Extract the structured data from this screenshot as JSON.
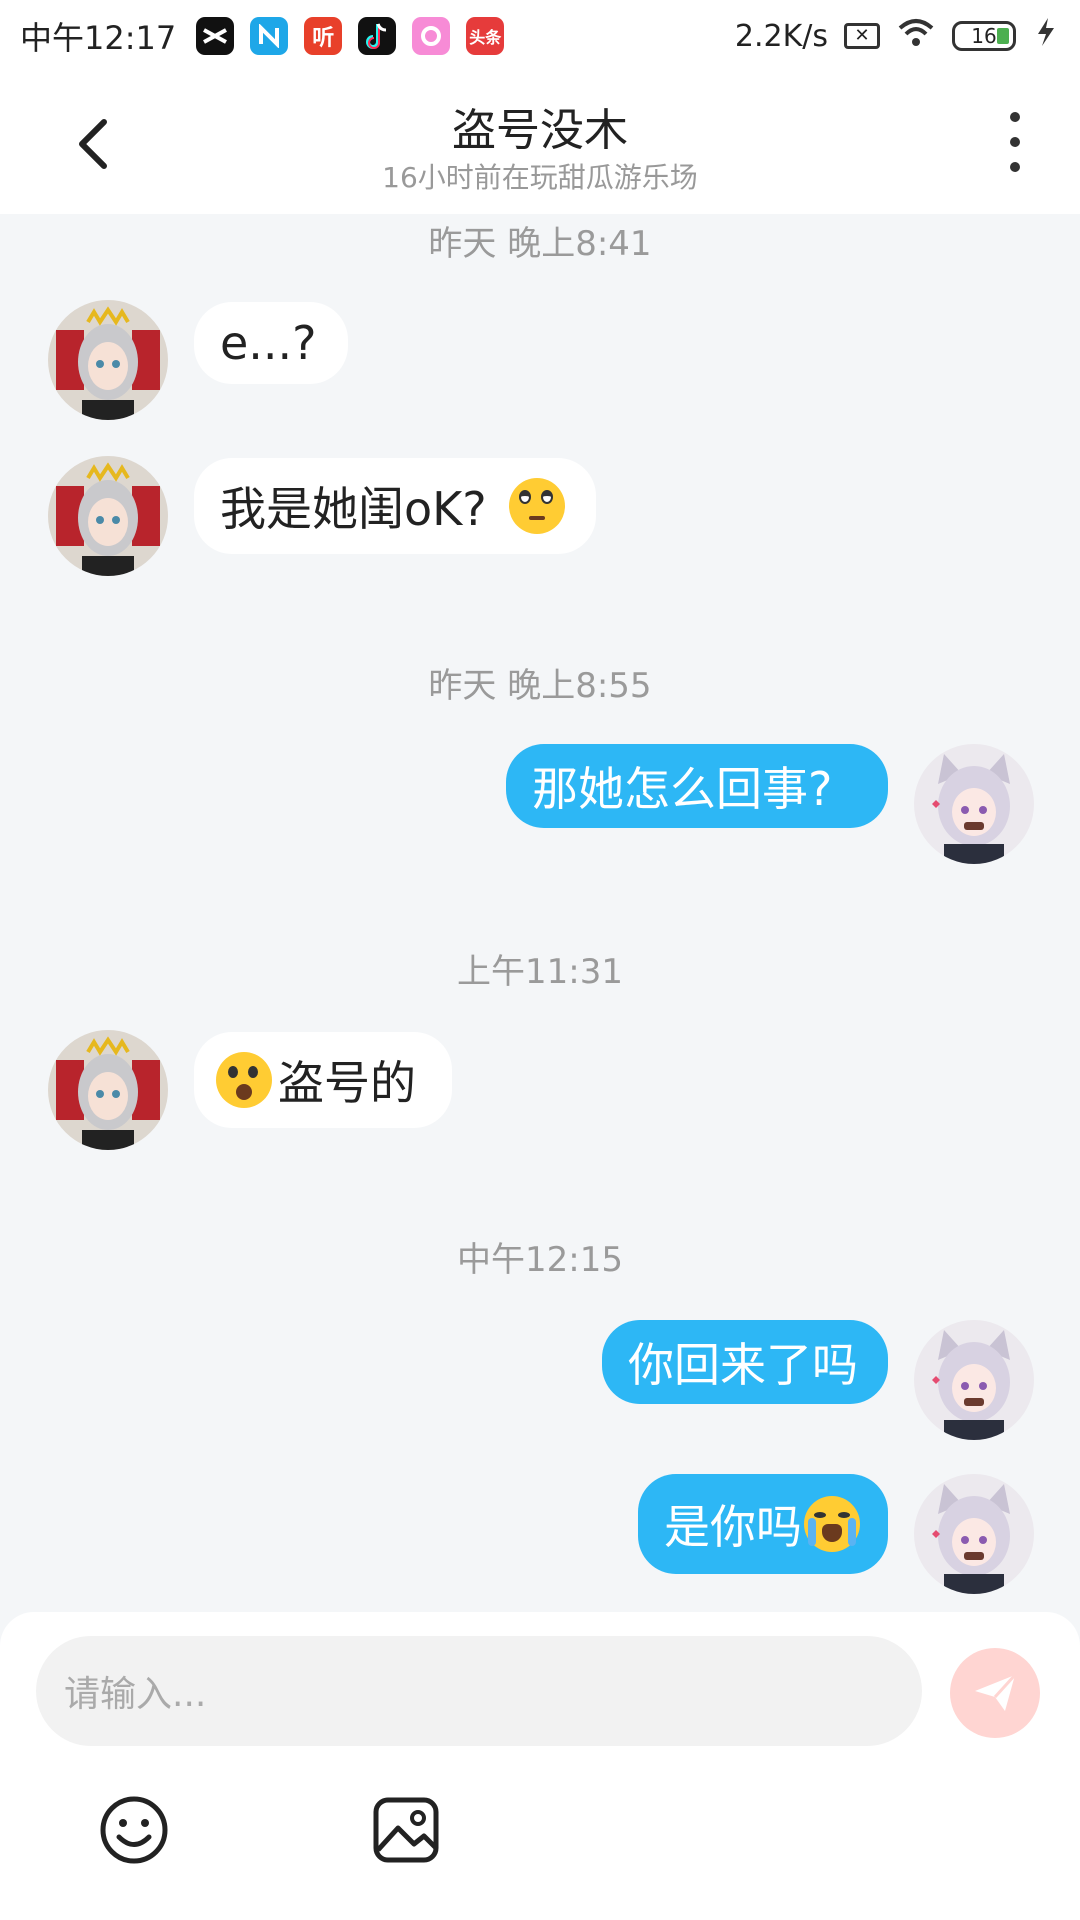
{
  "status_bar": {
    "time": "中午12:17",
    "network_speed": "2.2K/s",
    "battery": "16",
    "app_icons": [
      "capcut-icon",
      "n-icon",
      "ting-icon",
      "tiktok-icon",
      "camera-app-icon",
      "toutiao-icon"
    ],
    "ting_label": "听",
    "toutiao_label": "头条"
  },
  "header": {
    "title": "盗号没木",
    "subtitle": "16小时前在玩甜瓜游乐场"
  },
  "messages": [
    {
      "type": "timestamp",
      "text": "昨天 晚上8:41"
    },
    {
      "type": "incoming",
      "text": "e...?"
    },
    {
      "type": "incoming",
      "text": "我是她闺oK?",
      "emoji": "face-with-rolling-eyes"
    },
    {
      "type": "timestamp",
      "text": "昨天 晚上8:55"
    },
    {
      "type": "outgoing",
      "text": "那她怎么回事?"
    },
    {
      "type": "timestamp",
      "text": "上午11:31"
    },
    {
      "type": "incoming",
      "text": "盗号的",
      "emoji_before": "anguished-face"
    },
    {
      "type": "timestamp",
      "text": "中午12:15"
    },
    {
      "type": "outgoing",
      "text": "你回来了吗"
    },
    {
      "type": "outgoing",
      "text": "是你吗",
      "emoji": "loudly-crying-face"
    }
  ],
  "composer": {
    "placeholder": "请输入..."
  },
  "colors": {
    "outgoing_bubble": "#2db7f5",
    "incoming_bubble": "#ffffff",
    "background": "#f4f6f8",
    "send_button": "#ffd5d2"
  }
}
